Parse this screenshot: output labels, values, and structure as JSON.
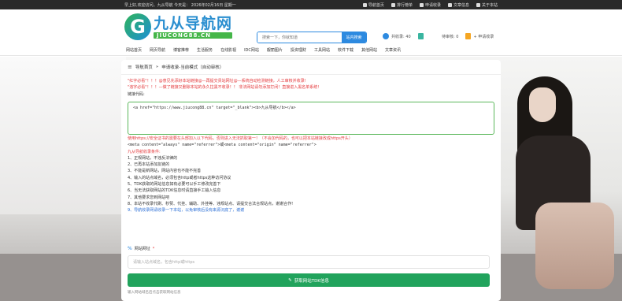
{
  "topbar": {
    "greeting": "早上好,欢迎访问。九从导航 今天是： 2026年02月16日 星期一",
    "links": [
      {
        "icon": "home-icon",
        "label": "导航首页"
      },
      {
        "icon": "chart-icon",
        "label": "排行榜单"
      },
      {
        "icon": "mail-icon",
        "label": "申请收录"
      },
      {
        "icon": "file-icon",
        "label": "文章信息"
      },
      {
        "icon": "info-icon",
        "label": "关于本站"
      }
    ]
  },
  "logo": {
    "mark": "G",
    "name": "九从导航网",
    "domain": "JIUCONG88.CN"
  },
  "search": {
    "placeholder": "搜索一下，你就知道",
    "button": "站内搜索"
  },
  "stats": [
    {
      "label": "共收录: 40",
      "color": "#2d8ae0"
    },
    {
      "label": "待审核: 0",
      "color": "#3aa5e0"
    },
    {
      "label": "+ 申请收录",
      "color": "#f5a623"
    }
  ],
  "nav": [
    "网站首页",
    "网页导航",
    "博客推荐",
    "生活服务",
    "在线影视",
    "IDC网站",
    "靓丽图片",
    "投资理财",
    "工具网站",
    "软件下载",
    "其他网站",
    "文章资讯"
  ],
  "breadcrumb": {
    "home": "导航首页",
    "arrow1": "»",
    "path": "申请收录-当前模式（自动审核）"
  },
  "notes": {
    "line1": "\"红字必看\"！！！@意见先添好本站链接@—再提交贵站网址@—系统自动检测链接，人工审核并收录!",
    "line2": "\"违字必看\"！！！—做了链接又删除本站的永久拉黑不收录！！ 非法网站请勿添加打闭！直接进入黑名单系统!",
    "label": "链接代码:"
  },
  "code": "<a href=\"https://www.jiucong88.cn\" target=\"_blank\"><b>九从导航</b></a>",
  "rules": {
    "https_note": "使用https://安全证书的需要在头部加入以下代码，否则进入无法抓取第一！（不会加代码的，也可以把本站链接改成https开头）",
    "meta": "<meta content=\"always\" name=\"referrer\">或<meta content=\"origin\" name=\"referrer\">",
    "title": "九从导航收录条件:",
    "items": [
      "1、正规网站，不违反法律的",
      "2、已再本站添加友链的",
      "3、不能是新网站，网站内容也不能不完善",
      "4、输入的站点域名，必须包含http或者https这种访问协议",
      "5、TDK获取的网站信息如有必要可以手工修改完善下",
      "6、当无法获取网站的TDK信息时请直接手工输入信息",
      "7、其他要求您到网站吧",
      "8、本站不收录代刷、秒赞、代挂、辅助、外挂等、违规站点、请提交合法合规站点，谢谢合作!",
      "9、导航收录网请收录一下本站，以免审核后没有来源沉底了，谢谢"
    ]
  },
  "form": {
    "label": "网站网址",
    "star": "*",
    "placeholder": "请输入站点域名，包含http或https",
    "button": "获取网站TDK信息",
    "hint": "输入网站域名后点击获取网站信息"
  }
}
